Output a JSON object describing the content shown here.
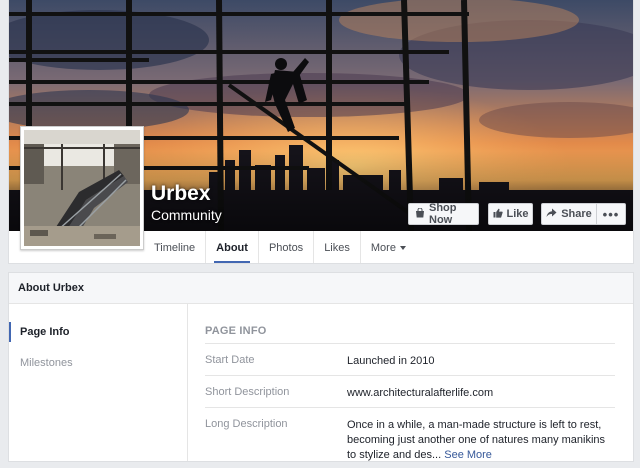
{
  "page": {
    "name": "Urbex",
    "category": "Community"
  },
  "actions": {
    "shop_now": "Shop Now",
    "like": "Like",
    "share": "Share",
    "more": "•••"
  },
  "tabs": [
    {
      "label": "Timeline"
    },
    {
      "label": "About"
    },
    {
      "label": "Photos"
    },
    {
      "label": "Likes"
    },
    {
      "label": "More"
    }
  ],
  "about": {
    "header": "About Urbex",
    "sidebar": [
      {
        "label": "Page Info"
      },
      {
        "label": "Milestones"
      }
    ],
    "section_title": "PAGE INFO",
    "rows": [
      {
        "label": "Start Date",
        "value": "Launched in 2010"
      },
      {
        "label": "Short Description",
        "value": "www.architecturalafterlife.com"
      },
      {
        "label": "Long Description",
        "value": "Once in a while, a man-made structure is left to rest, becoming just another one of natures many manikins to stylize and des...",
        "link": "See More"
      }
    ]
  },
  "colors": {
    "accent": "#4267b2",
    "link": "#365899",
    "muted": "#90949c",
    "background": "#e9ebee"
  }
}
